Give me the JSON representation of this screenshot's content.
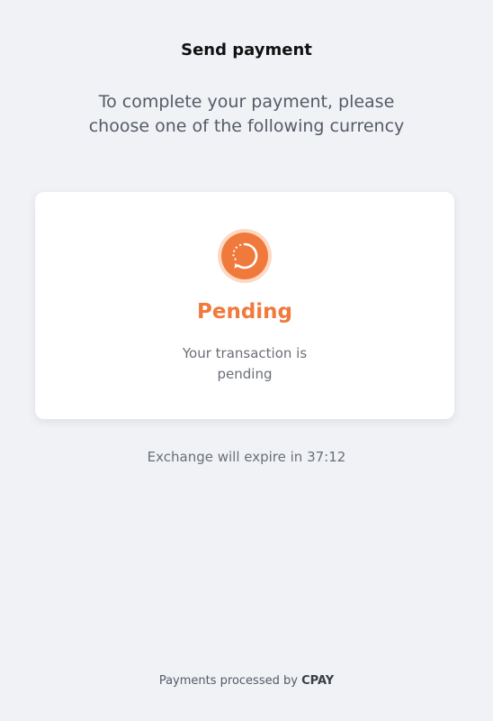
{
  "header": {
    "title": "Send payment",
    "subtitle": "To complete your payment, please choose one of the following currency"
  },
  "status_card": {
    "icon": "pending-spinner-icon",
    "title": "Pending",
    "message": "Your transaction is pending"
  },
  "expiry": {
    "text": "Exchange will expire in 37:12"
  },
  "footer": {
    "prefix": "Payments processed by",
    "brand": "CPAY"
  },
  "colors": {
    "background": "#f0f2f6",
    "card": "#ffffff",
    "accent": "#f07a3c",
    "accent_light": "#fcd9c4"
  }
}
